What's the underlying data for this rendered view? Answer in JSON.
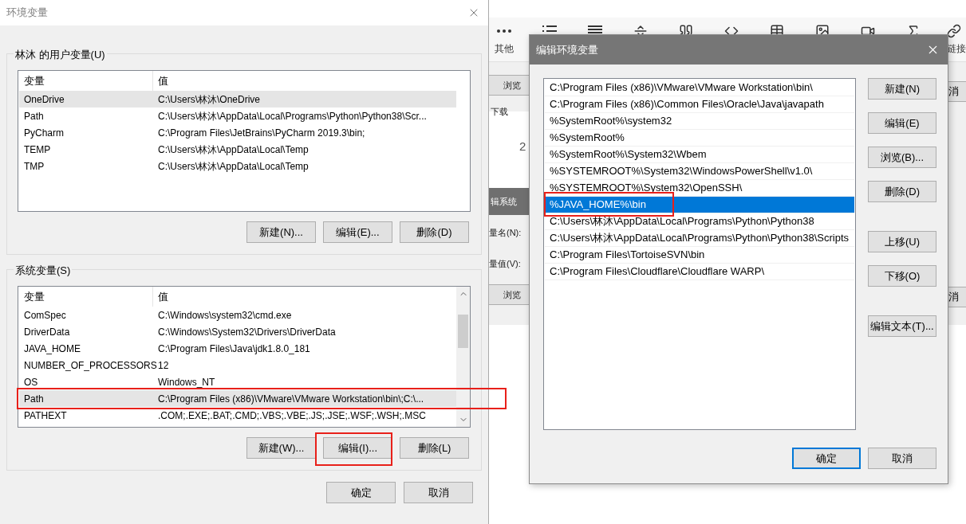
{
  "background": {
    "toolbar": [
      {
        "kind": "more",
        "label": "其他"
      },
      {
        "kind": "list"
      },
      {
        "kind": "align"
      },
      {
        "kind": "rule"
      },
      {
        "kind": "quote"
      },
      {
        "kind": "code"
      },
      {
        "kind": "table"
      },
      {
        "kind": "image"
      },
      {
        "kind": "video"
      },
      {
        "kind": "sigma"
      },
      {
        "kind": "link",
        "label": "链接"
      }
    ],
    "left_strip": {
      "browse_button": "浏览",
      "download": "下载",
      "number_1": "2",
      "dialog_title": "辑系统",
      "name_label": "量名(N):",
      "value_label": "量值(V):",
      "browse_button_2": "浏览"
    },
    "right_strip": {
      "cancel_1": "消",
      "cancel_2": "消"
    }
  },
  "env_dialog": {
    "title": "环境变量",
    "user_group": {
      "title": "林沐 的用户变量(U)",
      "columns": [
        "变量",
        "值"
      ],
      "rows": [
        {
          "name": "OneDrive",
          "value": "C:\\Users\\林沐\\OneDrive",
          "selected": true,
          "highlighted": false
        },
        {
          "name": "Path",
          "value": "C:\\Users\\林沐\\AppData\\Local\\Programs\\Python\\Python38\\Scr...",
          "selected": false,
          "highlighted": false
        },
        {
          "name": "PyCharm",
          "value": "C:\\Program Files\\JetBrains\\PyCharm 2019.3\\bin;",
          "selected": false,
          "highlighted": false
        },
        {
          "name": "TEMP",
          "value": "C:\\Users\\林沐\\AppData\\Local\\Temp",
          "selected": false,
          "highlighted": false
        },
        {
          "name": "TMP",
          "value": "C:\\Users\\林沐\\AppData\\Local\\Temp",
          "selected": false,
          "highlighted": false
        }
      ],
      "buttons": [
        {
          "label": "新建(N)...",
          "highlighted": false
        },
        {
          "label": "编辑(E)...",
          "highlighted": false
        },
        {
          "label": "删除(D)",
          "highlighted": false
        }
      ]
    },
    "system_group": {
      "title": "系统变量(S)",
      "columns": [
        "变量",
        "值"
      ],
      "rows": [
        {
          "name": "ComSpec",
          "value": "C:\\Windows\\system32\\cmd.exe",
          "selected": false,
          "highlighted": false
        },
        {
          "name": "DriverData",
          "value": "C:\\Windows\\System32\\Drivers\\DriverData",
          "selected": false,
          "highlighted": false
        },
        {
          "name": "JAVA_HOME",
          "value": "C:\\Program Files\\Java\\jdk1.8.0_181",
          "selected": false,
          "highlighted": false
        },
        {
          "name": "NUMBER_OF_PROCESSORS",
          "value": "12",
          "selected": false,
          "highlighted": false
        },
        {
          "name": "OS",
          "value": "Windows_NT",
          "selected": false,
          "highlighted": false
        },
        {
          "name": "Path",
          "value": "C:\\Program Files (x86)\\VMware\\VMware Workstation\\bin\\;C:\\...",
          "selected": true,
          "highlighted": true
        },
        {
          "name": "PATHEXT",
          "value": ".COM;.EXE;.BAT;.CMD;.VBS;.VBE;.JS;.JSE;.WSF;.WSH;.MSC",
          "selected": false,
          "highlighted": false
        }
      ],
      "buttons": [
        {
          "label": "新建(W)...",
          "highlighted": false
        },
        {
          "label": "编辑(I)...",
          "highlighted": true
        },
        {
          "label": "删除(L)",
          "highlighted": false
        }
      ]
    },
    "buttons": [
      {
        "label": "确定"
      },
      {
        "label": "取消"
      }
    ]
  },
  "edit_dialog": {
    "title": "编辑环境变量",
    "items": [
      {
        "text": "C:\\Program Files (x86)\\VMware\\VMware Workstation\\bin\\",
        "selected": false,
        "highlighted": false
      },
      {
        "text": "C:\\Program Files (x86)\\Common Files\\Oracle\\Java\\javapath",
        "selected": false,
        "highlighted": false
      },
      {
        "text": "%SystemRoot%\\system32",
        "selected": false,
        "highlighted": false
      },
      {
        "text": "%SystemRoot%",
        "selected": false,
        "highlighted": false
      },
      {
        "text": "%SystemRoot%\\System32\\Wbem",
        "selected": false,
        "highlighted": false
      },
      {
        "text": "%SYSTEMROOT%\\System32\\WindowsPowerShell\\v1.0\\",
        "selected": false,
        "highlighted": false
      },
      {
        "text": "%SYSTEMROOT%\\System32\\OpenSSH\\",
        "selected": false,
        "highlighted": false
      },
      {
        "text": "%JAVA_HOME%\\bin",
        "selected": true,
        "highlighted": true
      },
      {
        "text": "C:\\Users\\林沐\\AppData\\Local\\Programs\\Python\\Python38",
        "selected": false,
        "highlighted": false
      },
      {
        "text": "C:\\Users\\林沐\\AppData\\Local\\Programs\\Python\\Python38\\Scripts",
        "selected": false,
        "highlighted": false
      },
      {
        "text": "C:\\Program Files\\TortoiseSVN\\bin",
        "selected": false,
        "highlighted": false
      },
      {
        "text": "C:\\Program Files\\Cloudflare\\Cloudflare WARP\\",
        "selected": false,
        "highlighted": false
      }
    ],
    "side_buttons": [
      {
        "label": "新建(N)"
      },
      {
        "label": "编辑(E)"
      },
      {
        "label": "浏览(B)..."
      },
      {
        "label": "删除(D)"
      },
      {
        "label": "上移(U)"
      },
      {
        "label": "下移(O)"
      },
      {
        "label": "编辑文本(T)..."
      }
    ],
    "buttons": [
      {
        "label": "确定",
        "default": true
      },
      {
        "label": "取消",
        "default": false
      }
    ]
  }
}
